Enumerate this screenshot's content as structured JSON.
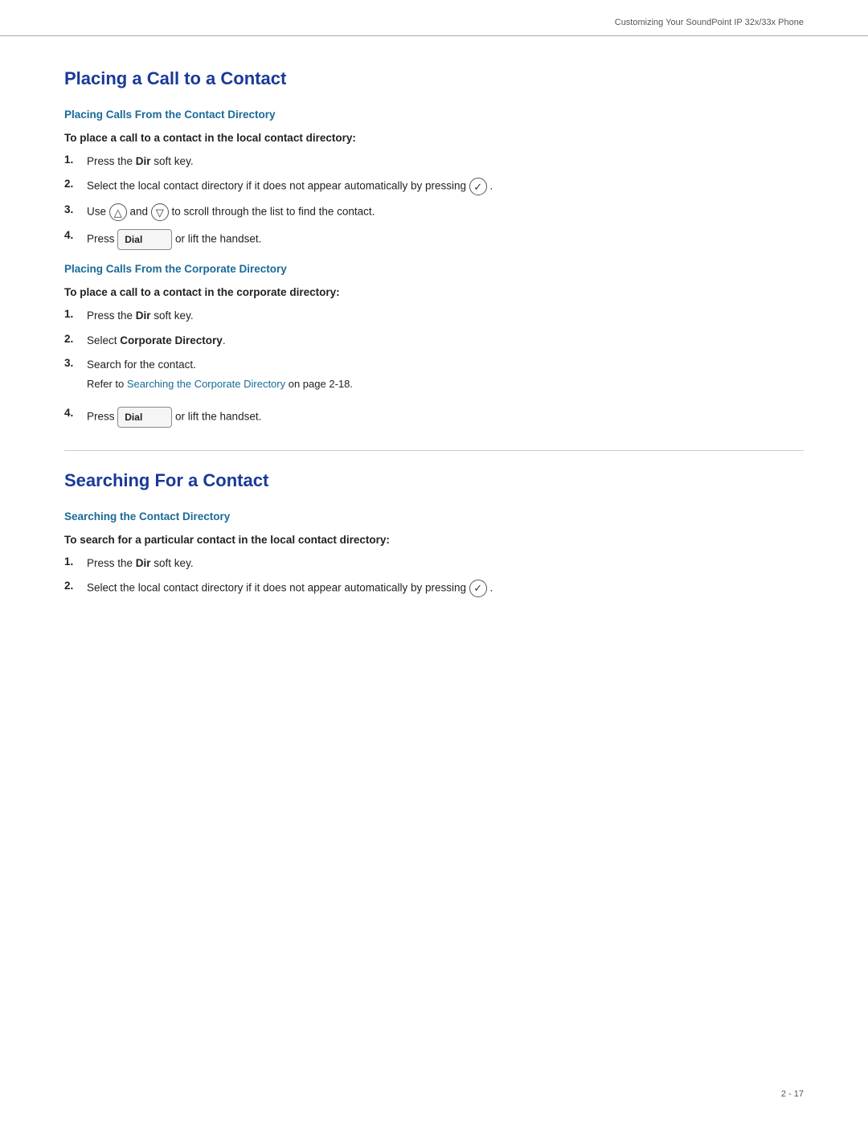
{
  "header": {
    "text": "Customizing Your SoundPoint IP 32x/33x Phone"
  },
  "sections": [
    {
      "id": "placing-call",
      "title": "Placing a Call to a Contact",
      "subsections": [
        {
          "id": "placing-local",
          "title": "Placing Calls From the Contact Directory",
          "procedure_title": "To place a call to a contact in the local contact directory:",
          "steps": [
            {
              "num": "1.",
              "text": "Press the ",
              "bold": "Dir",
              "text2": " soft key."
            },
            {
              "num": "2.",
              "text": "Select the local contact directory if it does not appear automatically by pressing",
              "has_check": true
            },
            {
              "num": "3.",
              "text_before": "Use",
              "has_up_arrow": true,
              "middle": "and",
              "has_down_arrow": true,
              "text_after": "to scroll through the list to find the contact."
            },
            {
              "num": "4.",
              "text": "Press",
              "has_dial": true,
              "text2": "or lift the handset."
            }
          ]
        },
        {
          "id": "placing-corporate",
          "title": "Placing Calls From the Corporate Directory",
          "procedure_title": "To place a call to a contact in the corporate directory:",
          "steps": [
            {
              "num": "1.",
              "text": "Press the ",
              "bold": "Dir",
              "text2": " soft key."
            },
            {
              "num": "2.",
              "text": "Select ",
              "bold": "Corporate Directory",
              "text2": "."
            },
            {
              "num": "3.",
              "text": "Search for the contact.",
              "has_ref": true,
              "ref_text": "Refer to ",
              "ref_link": "Searching the Corporate Directory",
              "ref_after": " on page 2-18."
            },
            {
              "num": "4.",
              "text": "Press",
              "has_dial": true,
              "text2": "or lift the handset."
            }
          ]
        }
      ]
    },
    {
      "id": "searching-contact",
      "title": "Searching For a Contact",
      "subsections": [
        {
          "id": "searching-local",
          "title": "Searching the Contact Directory",
          "procedure_title": "To search for a particular contact in the local contact directory:",
          "steps": [
            {
              "num": "1.",
              "text": "Press the ",
              "bold": "Dir",
              "text2": " soft key."
            },
            {
              "num": "2.",
              "text": "Select the local contact directory if it does not appear automatically by pressing",
              "has_check": true
            }
          ]
        }
      ]
    }
  ],
  "footer": {
    "page": "2 - 17"
  },
  "icons": {
    "check": "✓",
    "up_arrow": "△",
    "down_arrow": "▽",
    "dial_label": "Dial"
  }
}
